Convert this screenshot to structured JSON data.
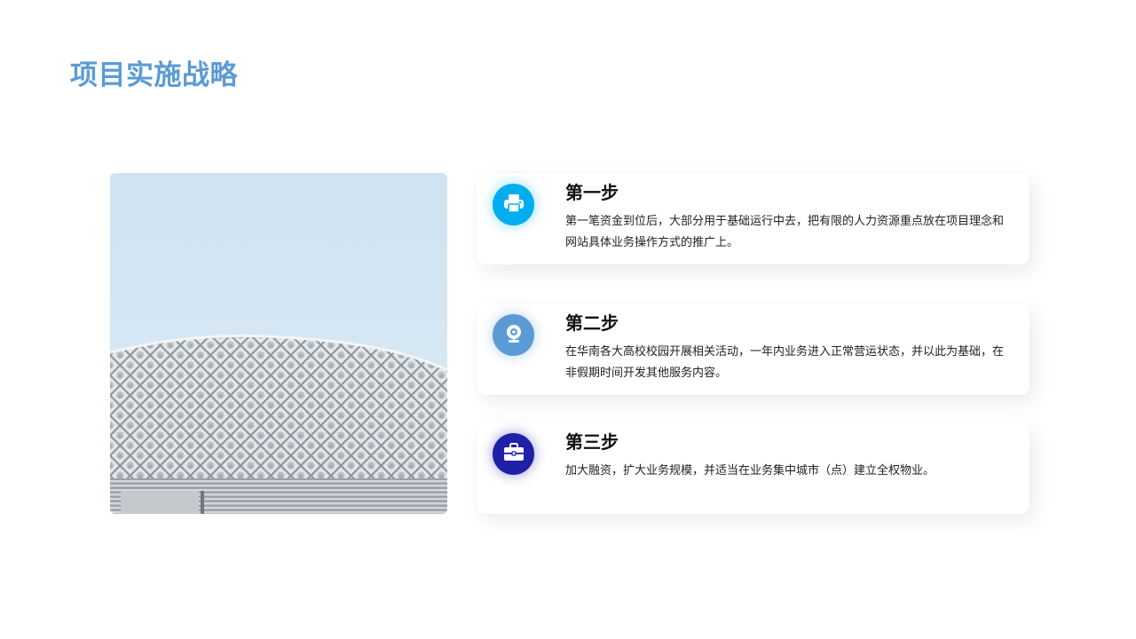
{
  "page": {
    "title": "项目实施战略",
    "title_color": "#5b9bd5"
  },
  "photo": {
    "icon": "building-photo"
  },
  "steps": [
    {
      "title": "第一步",
      "description": "第一笔资金到位后，大部分用于基础运行中去，把有限的人力资源重点放在项目理念和网站具体业务操作方式的推广上。",
      "icon": "printer-icon",
      "color": "#00aeef"
    },
    {
      "title": "第二步",
      "description": "在华南各大高校校园开展相关活动，一年内业务进入正常营运状态，并以此为基础，在非假期时间开发其他服务内容。",
      "icon": "webcam-icon",
      "color": "#5b9bd5"
    },
    {
      "title": "第三步",
      "description": "加大融资，扩大业务规模，并适当在业务集中城市（点）建立全权物业。",
      "icon": "briefcase-icon",
      "color": "#1f1fa8"
    }
  ]
}
